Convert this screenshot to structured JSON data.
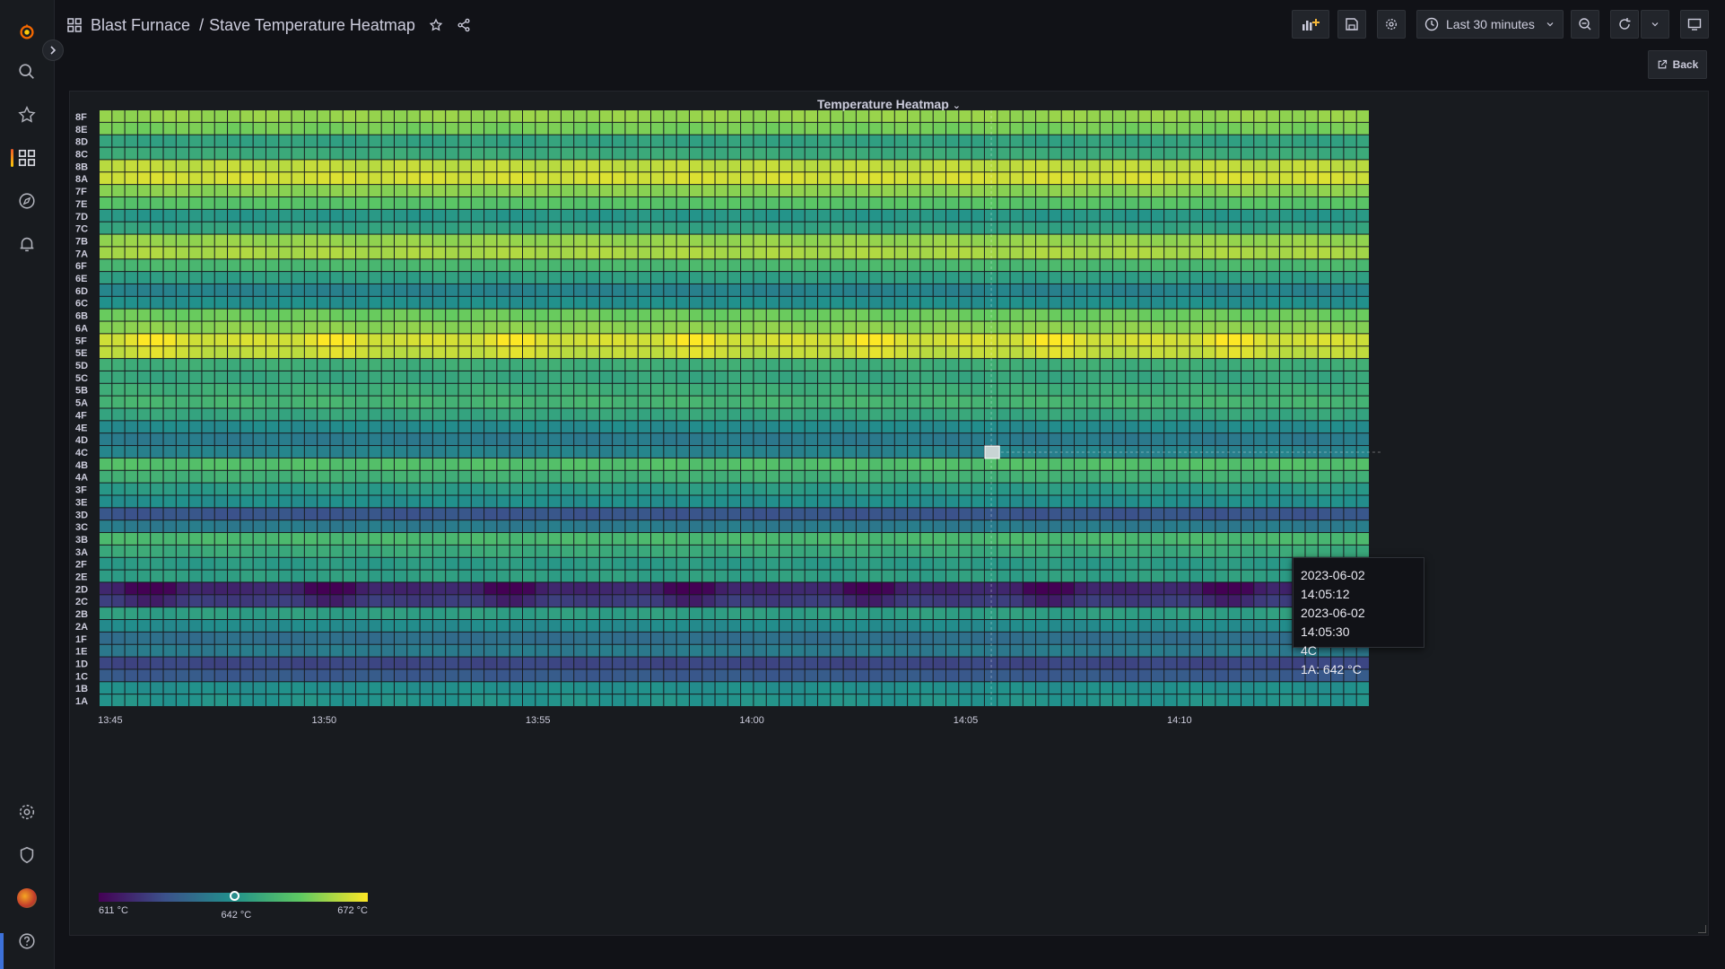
{
  "breadcrumb": {
    "folder": "Blast Furnace",
    "separator": "/",
    "dashboard": "Stave Temperature Heatmap"
  },
  "toolbar": {
    "time_range": "Last 30 minutes",
    "back_label": "Back"
  },
  "icons": {
    "sidebar": [
      "grafana-logo-icon",
      "search-icon",
      "star-icon",
      "dashboards-icon",
      "explore-icon",
      "alerting-icon",
      "settings-icon",
      "shield-icon",
      "avatar",
      "help-icon"
    ],
    "toolbar": [
      "add-panel-icon",
      "save-icon",
      "gear-icon",
      "clock-icon",
      "chevron-down-icon",
      "zoom-out-icon",
      "refresh-icon",
      "chevron-down-icon",
      "tv-icon"
    ]
  },
  "colors": {
    "background": "#111217",
    "panel": "#181b1f",
    "accent": "#f05a28"
  },
  "panel": {
    "title": "Temperature Heatmap"
  },
  "tooltip": {
    "line1": "2023-06-02 14:05:12",
    "line2": "2023-06-02 14:05:30",
    "line3": "4C",
    "line4": "1A: 642 °C"
  },
  "legend": {
    "min_label": "611 °C",
    "mid_label": "642 °C",
    "max_label": "672 °C",
    "min": 611,
    "max": 672,
    "marker_value": 642
  },
  "chart_data": {
    "type": "heatmap",
    "title": "Temperature Heatmap",
    "colorscale": "viridis",
    "value_range": [
      611,
      672
    ],
    "unit": "°C",
    "y_categories": [
      "1A",
      "1B",
      "1C",
      "1D",
      "1E",
      "1F",
      "2A",
      "2B",
      "2C",
      "2D",
      "2E",
      "2F",
      "3A",
      "3B",
      "3C",
      "3D",
      "3E",
      "3F",
      "4A",
      "4B",
      "4C",
      "4D",
      "4E",
      "4F",
      "5A",
      "5B",
      "5C",
      "5D",
      "5E",
      "5F",
      "6A",
      "6B",
      "6C",
      "6D",
      "6E",
      "6F",
      "7A",
      "7B",
      "7C",
      "7D",
      "7E",
      "7F",
      "8A",
      "8B",
      "8C",
      "8D",
      "8E",
      "8F"
    ],
    "x_tick_labels": [
      "13:45",
      "13:50",
      "13:55",
      "14:00",
      "14:05",
      "14:10"
    ],
    "x_tick_minutes": [
      13.75,
      18.75,
      23.75,
      28.75,
      33.75,
      38.75
    ],
    "x_range_minutes": [
      13.5,
      43.2
    ],
    "bucket_seconds": 18,
    "row_base_values": [
      642,
      641,
      628,
      624,
      636,
      633,
      640,
      645,
      622,
      618,
      645,
      644,
      648,
      652,
      636,
      627,
      641,
      644,
      650,
      654,
      638,
      636,
      640,
      647,
      651,
      649,
      647,
      649,
      666,
      668,
      661,
      658,
      641,
      638,
      645,
      652,
      664,
      662,
      646,
      643,
      655,
      661,
      668,
      666,
      648,
      646,
      659,
      662
    ],
    "row_anomaly_deltas": {
      "2C": -6,
      "2D": -13,
      "5E": 4,
      "5F": 5
    },
    "anomaly_period_minutes": 4.2
  }
}
